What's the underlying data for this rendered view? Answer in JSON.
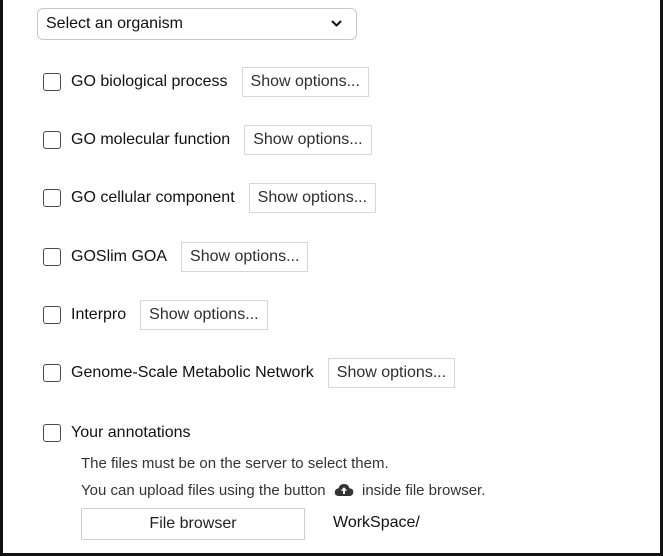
{
  "organism_select": {
    "value": "Select an organism"
  },
  "options": [
    {
      "label": "GO biological process",
      "button": "Show options..."
    },
    {
      "label": "GO molecular function",
      "button": "Show options..."
    },
    {
      "label": "GO cellular component",
      "button": "Show options..."
    },
    {
      "label": "GOSlim GOA",
      "button": "Show options..."
    },
    {
      "label": "Interpro",
      "button": "Show options..."
    },
    {
      "label": "Genome-Scale Metabolic Network",
      "button": "Show options..."
    }
  ],
  "annotations": {
    "label": "Your annotations",
    "note_line1": "The files must be on the server to select them.",
    "note_line2_before": "You can upload files using the button",
    "note_line2_after": "inside file browser.",
    "upload_icon": "cloud-upload-icon",
    "file_browser_button": "File browser",
    "path": "WorkSpace/"
  }
}
